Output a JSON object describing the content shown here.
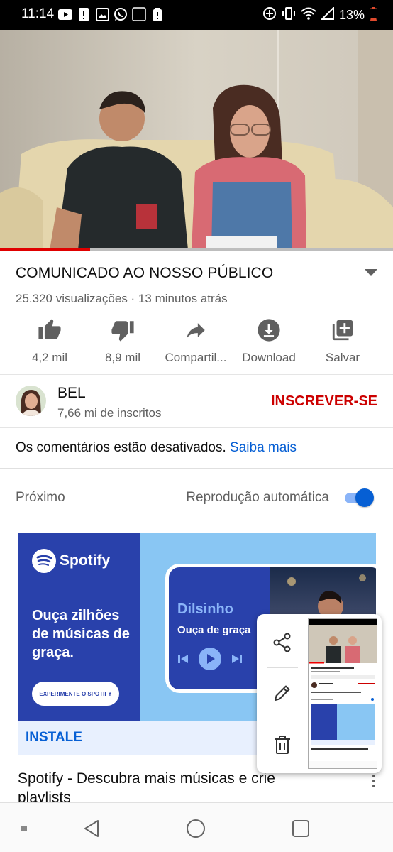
{
  "status_bar": {
    "time": "11:14",
    "battery": "13%",
    "icons_left": [
      "youtube-icon",
      "alert-icon",
      "gallery-icon",
      "whatsapp-icon",
      "lightroom-icon",
      "battery-alert-icon"
    ],
    "icons_right": [
      "data-saver-icon",
      "vibrate-icon",
      "wifi-icon",
      "signal-icon",
      "battery-icon"
    ],
    "lightroom_text": "Lr"
  },
  "video": {
    "progress_fraction": 0.23,
    "colors": {
      "progress": "#e00000",
      "track": "#bdbdbd"
    }
  },
  "title": "COMUNICADO AO NOSSO PÚBLICO",
  "meta": "25.320 visualizações · 13 minutos atrás",
  "actions": [
    {
      "icon": "thumb-up-icon",
      "label": "4,2 mil"
    },
    {
      "icon": "thumb-down-icon",
      "label": "8,9 mil"
    },
    {
      "icon": "share-icon",
      "label": "Compartil..."
    },
    {
      "icon": "download-icon",
      "label": "Download"
    },
    {
      "icon": "playlist-add-icon",
      "label": "Salvar"
    }
  ],
  "channel": {
    "name": "BEL",
    "subscribers": "7,66 mi de inscritos",
    "subscribe_label": "INSCREVER-SE"
  },
  "comments": {
    "text": "Os comentários estão desativados.",
    "link": "Saiba mais"
  },
  "next": {
    "label": "Próximo",
    "autoplay_label": "Reprodução automática",
    "autoplay_on": true
  },
  "ad": {
    "brand": "Spotify",
    "headline": "Ouça zilhões de músicas de graça.",
    "cta": "EXPERIMENTE O SPOTIFY",
    "artist": "Dilsinho",
    "phone_subtitle": "Ouça de graça",
    "install_label": "INSTALE",
    "colors": {
      "left": "#2941ab",
      "right": "#89c6f3",
      "band": "#e8f0fe"
    }
  },
  "next_video_title": "Spotify - Descubra mais músicas e crie playlists",
  "screenshot_preview": {
    "tools": [
      "share-icon",
      "edit-icon",
      "delete-icon"
    ]
  },
  "nav": [
    "recents-dot-icon",
    "back-icon",
    "home-icon",
    "overview-icon"
  ]
}
